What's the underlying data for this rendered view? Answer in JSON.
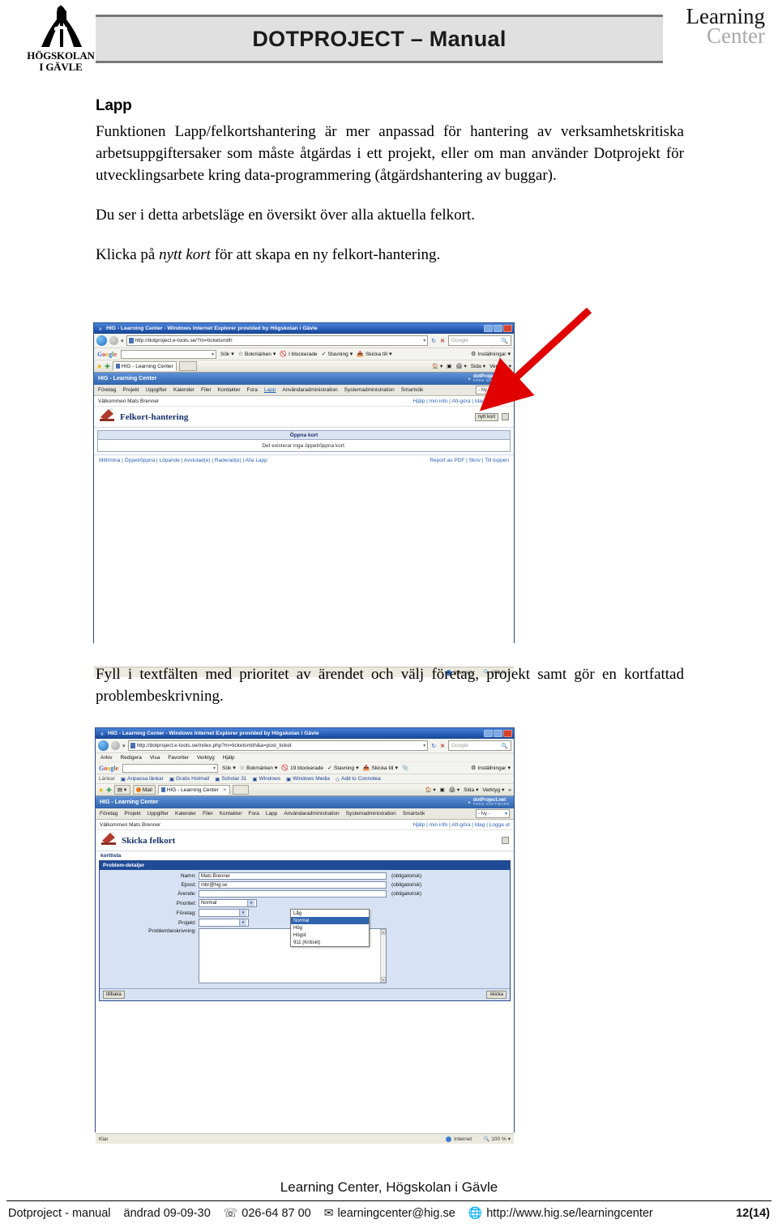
{
  "header": {
    "org_line1": "HÖGSKOLAN",
    "org_line2": "I GÄVLE",
    "title": "DOTPROJECT – Manual",
    "lc_line1": "Learning",
    "lc_line2": "Center"
  },
  "content": {
    "section_heading": "Lapp",
    "paragraph1": "Funktionen Lapp/felkortshantering är mer anpassad för hantering av verksamhetskritiska arbetsuppgiftersaker som måste åtgärdas i ett projekt, eller om man använder Dotprojekt för utvecklingsarbete kring data-programmering (åtgärdshantering av buggar).",
    "paragraph2": "Du ser i detta arbetsläge en översikt över alla aktuella felkort.",
    "paragraph3_pre": "Klicka på ",
    "paragraph3_italic": "nytt kort",
    "paragraph3_post": " för att skapa en ny felkort-hantering.",
    "paragraph4": "Fyll i textfälten med prioritet av ärendet och välj företag, projekt samt gör en kortfattad problembeskrivning."
  },
  "screenshot1": {
    "window_title": "HIG - Learning Center - Windows Internet Explorer provided by Högskolan i Gävle",
    "url": "http://dotproject.e-tools.se/?m=ticketsmith",
    "search_placeholder": "Google",
    "google": {
      "logo": "Google",
      "search_box": "",
      "items": [
        "Sök",
        "Bokmärken",
        "I blockerade",
        "Stavning",
        "Skicka till"
      ],
      "settings": "Inställningar"
    },
    "tab_label": "HIG - Learning Center",
    "tab_right": [
      "Sida",
      "Verktyg"
    ],
    "dp_header": "HIG - Learning Center",
    "brand_line1": "dotProject.net",
    "brand_line2": "FREE SOFTWARE",
    "nav": [
      "Företag",
      "Projekt",
      "Uppgifter",
      "Kalender",
      "Filer",
      "Kontakter",
      "Fora",
      "Lapp",
      "Användaradministration",
      "Systemadministration",
      "Smartsök"
    ],
    "nav_current": "Lapp",
    "new_select": "- Ny -",
    "welcome": "Välkommen Mats Brenner",
    "user_links": "Hjälp | min info | Att-göra | Idag | Logga ut",
    "page_title": "Felkort-hantering",
    "new_card_button": "nytt kort",
    "panel_header": "Öppna kort",
    "panel_body": "Det existerar inga öppet/öppna kort.",
    "footer_links_left": "Mitt/mina | Öppet/öppna | Löpande | Avslutad(e) | Raderad(e) | Alla Lapp",
    "footer_links_right": "Report as PDF | Skriv | Till toppen",
    "status_text": "",
    "status_zone": "Internet",
    "status_zoom": "100 %"
  },
  "screenshot2": {
    "window_title": "HIG - Learning Center - Windows Internet Explorer provided by Högskolan i Gävle",
    "url": "http://dotproject.e-tools.se/index.php?m=ticketsmith&a=post_ticket",
    "search_placeholder": "Google",
    "menu": [
      "Arkiv",
      "Redigera",
      "Visa",
      "Favoriter",
      "Verktyg",
      "Hjälp"
    ],
    "google": {
      "logo": "Google",
      "search_box": "",
      "items": [
        "Sök",
        "Bokmärken",
        "19 blockerade",
        "Stavning",
        "Skicka till"
      ],
      "settings": "Inställningar"
    },
    "links_bar": [
      "Länkar",
      "Anpassa länkar",
      "Gratis Hotmail",
      "Scholar 31",
      "Windows",
      "Windows Media",
      "Add to Connotea"
    ],
    "tab_mail": "Mail",
    "tab_label": "HIG - Learning Center",
    "tab_right": [
      "Sida",
      "Verktyg"
    ],
    "dp_header": "HIG - Learning Center",
    "brand_line1": "dotProject.net",
    "brand_line2": "FREE SOFTWARE",
    "nav": [
      "Företag",
      "Projekt",
      "Uppgifter",
      "Kalender",
      "Filer",
      "Kontakter",
      "Fora",
      "Lapp",
      "Användaradministration",
      "Systemadministration",
      "Smartsök"
    ],
    "nav_current": "Lapp",
    "new_select": "- Ny -",
    "welcome": "Välkommen Mats Brenner",
    "user_links": "Hjälp | min info | Att-göra | Idag | Logga ut",
    "page_title": "Skicka felkort",
    "kortlista": "kortlista",
    "form_header": "Problem-detaljer",
    "fields": [
      {
        "label": "Namn:",
        "value": "Mats Brenner",
        "note": "(obligatorisk)"
      },
      {
        "label": "Epost:",
        "value": "mbr@hig.se",
        "note": "(obligatorisk)"
      },
      {
        "label": "Ärende:",
        "value": "",
        "note": "(obligatorisk)"
      }
    ],
    "priority_label": "Prioritet:",
    "priority_value": "Normal",
    "priority_options": [
      "Låg",
      "Normal",
      "Hög",
      "Högst",
      "911 (Kritiskt)"
    ],
    "priority_selected_index": 1,
    "company_label": "Företag:",
    "company_value": "",
    "project_label": "Projekt:",
    "project_value": "",
    "description_label": "Problembeskrivning:",
    "description_value": "",
    "back_button": "tillbaka",
    "send_button": "skicka",
    "status_text": "Klar",
    "status_zone": "Internet",
    "status_zoom": "100 %"
  },
  "footer": {
    "center": "Learning Center, Högskolan i Gävle",
    "doc": "Dotproject - manual",
    "changed": "ändrad 09-09-30",
    "phone": "026-64 87 00",
    "email": "learningcenter@hig.se",
    "web": "http://www.hig.se/learningcenter",
    "page": "12(14)"
  }
}
